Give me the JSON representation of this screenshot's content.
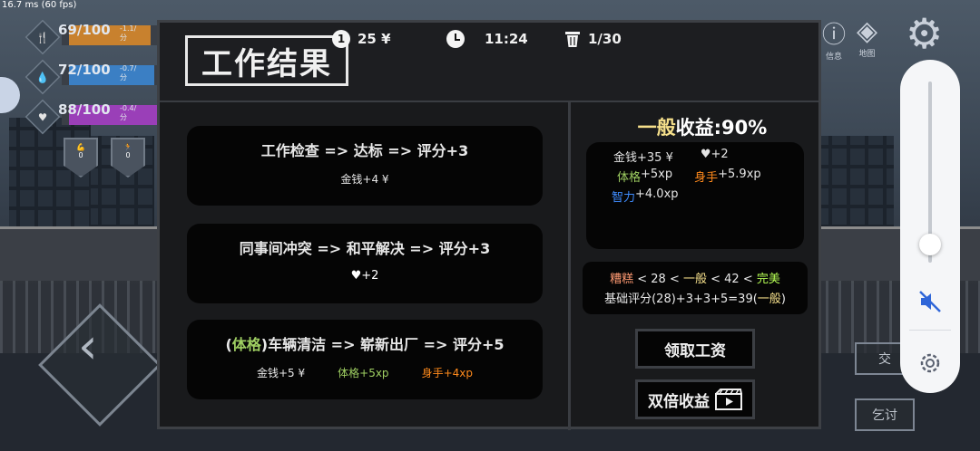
{
  "fps": "16.7 ms (60 fps)",
  "hud": {
    "stats": [
      {
        "icon": "fork-knife-icon",
        "glyph": "🍴",
        "value": "69/100",
        "delta": "-1.1/分",
        "fill_fraction": 0.69,
        "color": "#c8812e"
      },
      {
        "icon": "water-drop-icon",
        "glyph": "💧",
        "value": "72/100",
        "delta": "-0.7/分",
        "fill_fraction": 0.72,
        "color": "#3b7fc4"
      },
      {
        "icon": "heart-pulse-icon",
        "glyph": "♥",
        "value": "88/100",
        "delta": "-0.4/分",
        "fill_fraction": 0.88,
        "color": "#9a3fb8"
      }
    ],
    "badges": [
      {
        "value": "0"
      },
      {
        "value": "0"
      }
    ],
    "top_icons": [
      {
        "label": "信息",
        "icon": "info-icon"
      },
      {
        "label": "地图",
        "icon": "map-icon"
      },
      {
        "label": "",
        "icon": "gear-icon"
      }
    ],
    "side_buttons": [
      "交",
      "乞讨"
    ]
  },
  "modal": {
    "title": "工作结果",
    "money": "25 ¥",
    "coin_label": "1",
    "time": "11:24",
    "trash": "1/30",
    "events": [
      {
        "line1_parts": [
          {
            "text": "工作检查 => 达标 => 评分+3",
            "cls": ""
          }
        ],
        "line2_parts": [
          {
            "text": "金钱+4 ¥",
            "cls": ""
          }
        ]
      },
      {
        "line1_parts": [
          {
            "text": "同事间冲突 => 和平解决 => 评分+3",
            "cls": ""
          }
        ],
        "line2_parts": [
          {
            "text": "♥+2",
            "cls": "heart"
          }
        ]
      },
      {
        "line1_parts": [
          {
            "text": "(",
            "cls": ""
          },
          {
            "text": "体格",
            "cls": "green"
          },
          {
            "text": ")车辆清洁 => 崭新出厂 => 评分+5",
            "cls": ""
          }
        ],
        "line2_parts": [
          {
            "text": "金钱+5 ¥",
            "cls": ""
          },
          {
            "text": "体格+5xp",
            "cls": "green"
          },
          {
            "text": "身手+4xp",
            "cls": "orange"
          }
        ]
      }
    ],
    "income_title_prefix": "一般",
    "income_title_suffix": "收益:90%",
    "income_lines": [
      [
        {
          "text": "金钱+35 ¥",
          "cls": ""
        },
        {
          "text": "♥+2",
          "cls": ""
        }
      ],
      [
        {
          "text": "体格",
          "cls": "green"
        },
        {
          "text": "+5xp",
          "cls": ""
        },
        {
          "text": "身手",
          "cls": "orange"
        },
        {
          "text": "+5.9xp",
          "cls": ""
        }
      ],
      [
        {
          "text": "智力",
          "cls": "blue"
        },
        {
          "text": "+4.0xp",
          "cls": ""
        }
      ]
    ],
    "rating_line1": [
      {
        "text": "糟糕",
        "cls": "salmon"
      },
      {
        "text": " < 28 < ",
        "cls": ""
      },
      {
        "text": "一般",
        "cls": "yellow"
      },
      {
        "text": " < 42 < ",
        "cls": ""
      },
      {
        "text": "完美",
        "cls": "lgreen"
      }
    ],
    "rating_line2": [
      {
        "text": "基础评分(28)+3+3+5=39(",
        "cls": ""
      },
      {
        "text": "一般",
        "cls": "yellow"
      },
      {
        "text": ")",
        "cls": ""
      }
    ],
    "buttons": {
      "collect": "领取工资",
      "double": "双倍收益"
    }
  },
  "volume": {
    "level": 0.1,
    "muted": true
  }
}
